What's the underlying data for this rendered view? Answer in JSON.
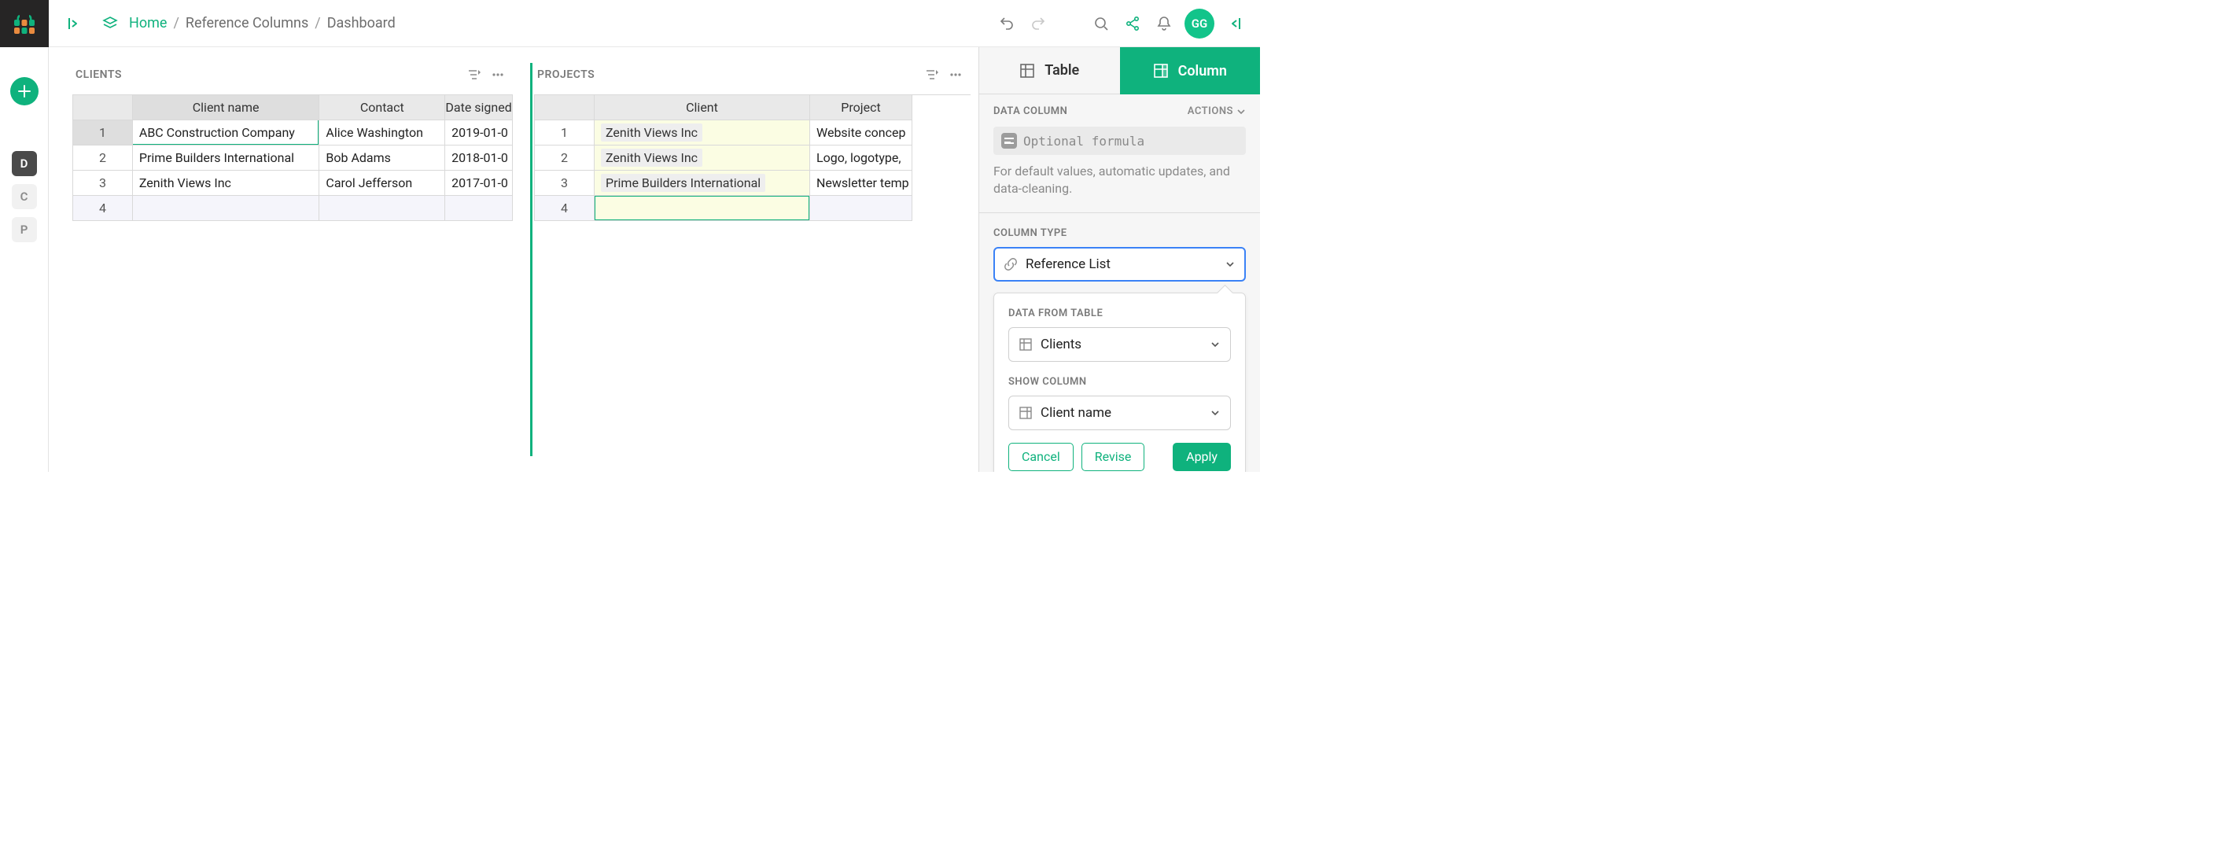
{
  "topbar": {
    "breadcrumb": {
      "home": "Home",
      "seg1": "Reference Columns",
      "seg2": "Dashboard"
    },
    "avatar": "GG"
  },
  "sidebar": {
    "items": [
      {
        "label": "D",
        "active": true
      },
      {
        "label": "C",
        "active": false
      },
      {
        "label": "P",
        "active": false
      }
    ]
  },
  "tables": {
    "clients": {
      "title": "CLIENTS",
      "columns": [
        "Client name",
        "Contact",
        "Date signed"
      ],
      "rows": [
        {
          "n": "1",
          "cells": [
            "ABC Construction Company",
            "Alice Washington",
            "2019-01-0"
          ]
        },
        {
          "n": "2",
          "cells": [
            "Prime Builders International",
            "Bob Adams",
            "2018-01-0"
          ]
        },
        {
          "n": "3",
          "cells": [
            "Zenith Views Inc",
            "Carol Jefferson",
            "2017-01-0"
          ]
        }
      ],
      "new_row_n": "4"
    },
    "projects": {
      "title": "PROJECTS",
      "columns": [
        "Client",
        "Project"
      ],
      "rows": [
        {
          "n": "1",
          "cells": [
            "Zenith Views Inc",
            "Website concep"
          ]
        },
        {
          "n": "2",
          "cells": [
            "Zenith Views Inc",
            "Logo, logotype,"
          ]
        },
        {
          "n": "3",
          "cells": [
            "Prime Builders International",
            "Newsletter temp"
          ]
        }
      ],
      "new_row_n": "4"
    }
  },
  "panel": {
    "tabs": {
      "table": "Table",
      "column": "Column"
    },
    "data_column_label": "DATA COLUMN",
    "actions_label": "ACTIONS",
    "formula_placeholder": "Optional formula",
    "help_text": "For default values, automatic updates, and data-cleaning.",
    "column_type_label": "COLUMN TYPE",
    "column_type_value": "Reference List",
    "data_from_table_label": "DATA FROM TABLE",
    "data_from_table_value": "Clients",
    "show_column_label": "SHOW COLUMN",
    "show_column_value": "Client name",
    "buttons": {
      "cancel": "Cancel",
      "revise": "Revise",
      "apply": "Apply"
    }
  }
}
